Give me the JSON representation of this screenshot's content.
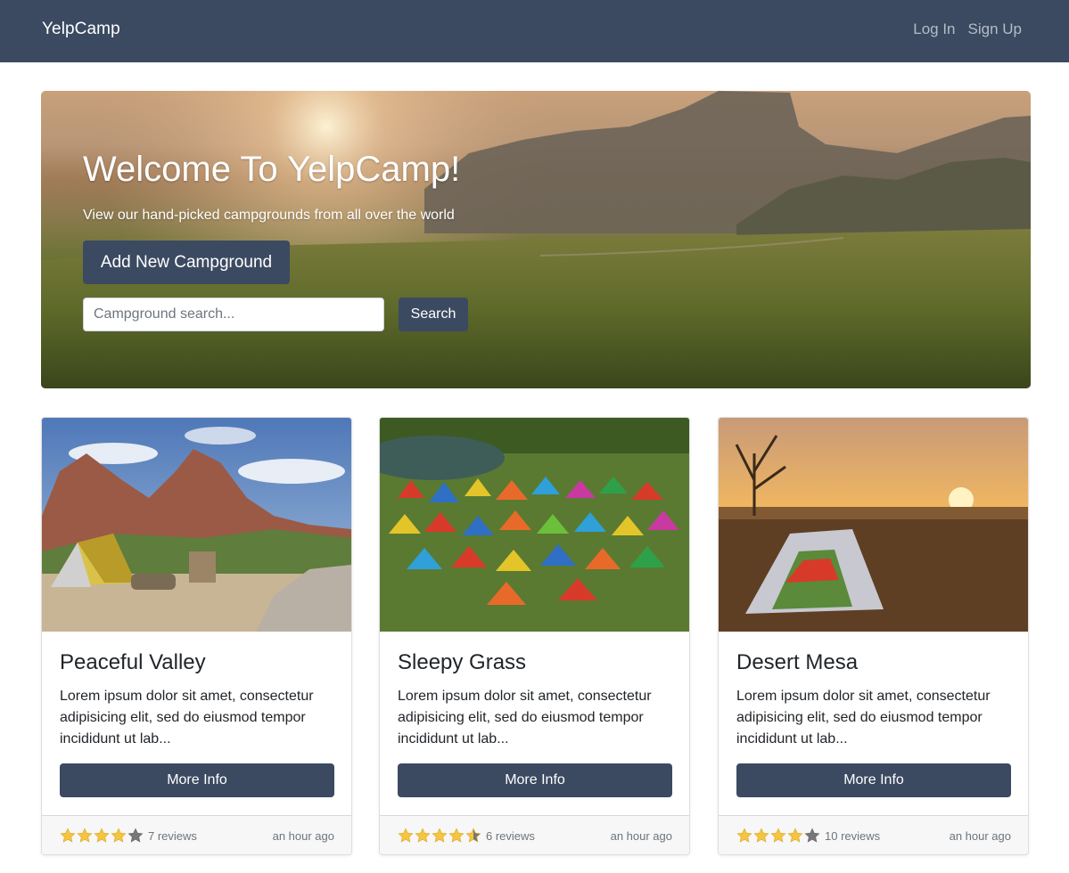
{
  "navbar": {
    "brand": "YelpCamp",
    "links": [
      "Log In",
      "Sign Up"
    ]
  },
  "hero": {
    "title": "Welcome To YelpCamp!",
    "subtitle": "View our hand-picked campgrounds from all over the world",
    "add_button": "Add New Campground",
    "search_placeholder": "Campground search...",
    "search_button": "Search"
  },
  "cards": [
    {
      "title": "Peaceful Valley",
      "description": "Lorem ipsum dolor sit amet, consectetur adipisicing elit, sed do eiusmod tempor incididunt ut lab...",
      "button": "More Info",
      "rating": 4,
      "reviews": "7 reviews",
      "time": "an hour ago"
    },
    {
      "title": "Sleepy Grass",
      "description": "Lorem ipsum dolor sit amet, consectetur adipisicing elit, sed do eiusmod tempor incididunt ut lab...",
      "button": "More Info",
      "rating": 4.5,
      "reviews": "6 reviews",
      "time": "an hour ago"
    },
    {
      "title": "Desert Mesa",
      "description": "Lorem ipsum dolor sit amet, consectetur adipisicing elit, sed do eiusmod tempor incididunt ut lab...",
      "button": "More Info",
      "rating": 4,
      "reviews": "10 reviews",
      "time": "an hour ago"
    }
  ],
  "colors": {
    "navbar": "#3b4a61",
    "button": "#3b4a61",
    "star_filled": "#f5c542",
    "star_empty": "#777777"
  },
  "icons": {
    "rating": "star-icon"
  }
}
